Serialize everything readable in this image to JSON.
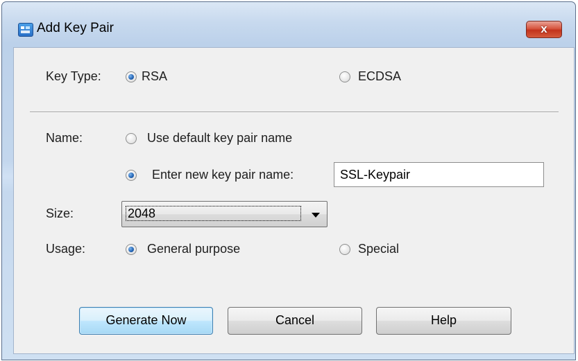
{
  "window": {
    "title": "Add Key Pair",
    "close_label": "x",
    "app_icon": "key-pair-app-icon"
  },
  "key_type": {
    "label": "Key Type:",
    "options": [
      {
        "label": "RSA",
        "checked": true
      },
      {
        "label": "ECDSA",
        "checked": false
      }
    ]
  },
  "name": {
    "label": "Name:",
    "default_option": {
      "label": "Use default key pair name",
      "checked": false
    },
    "new_option": {
      "label": "Enter new key pair name:",
      "checked": true
    },
    "value": "SSL-Keypair"
  },
  "size": {
    "label": "Size:",
    "selected": "2048"
  },
  "usage": {
    "label": "Usage:",
    "options": [
      {
        "label": "General purpose",
        "checked": true
      },
      {
        "label": "Special",
        "checked": false
      }
    ]
  },
  "buttons": {
    "generate": "Generate Now",
    "cancel": "Cancel",
    "help": "Help"
  },
  "colors": {
    "window_frame": "#c7d9ee",
    "client_bg": "#f0f0f0",
    "close_button": "#c2331c",
    "default_button": "#bee6fd"
  }
}
